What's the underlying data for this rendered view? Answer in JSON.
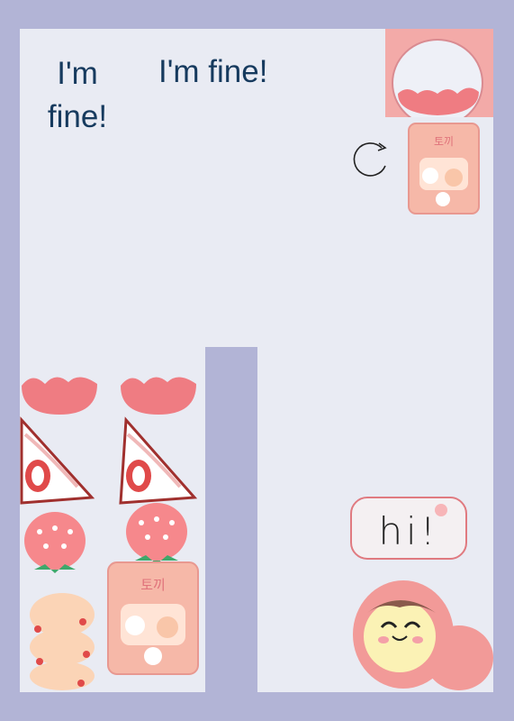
{
  "texts": {
    "stacked": "I'm fine!",
    "inline": "I'm fine!"
  },
  "bubble": {
    "label": "hi!"
  },
  "stickers": {
    "snack_bag_label": "토끼",
    "snack_bag_big_label": "토끼"
  },
  "colors": {
    "background": "#b2b4d6",
    "paper": "#e9ebf3",
    "text": "#163a5e",
    "pink": "#f3a3a8",
    "red": "#e05050"
  }
}
